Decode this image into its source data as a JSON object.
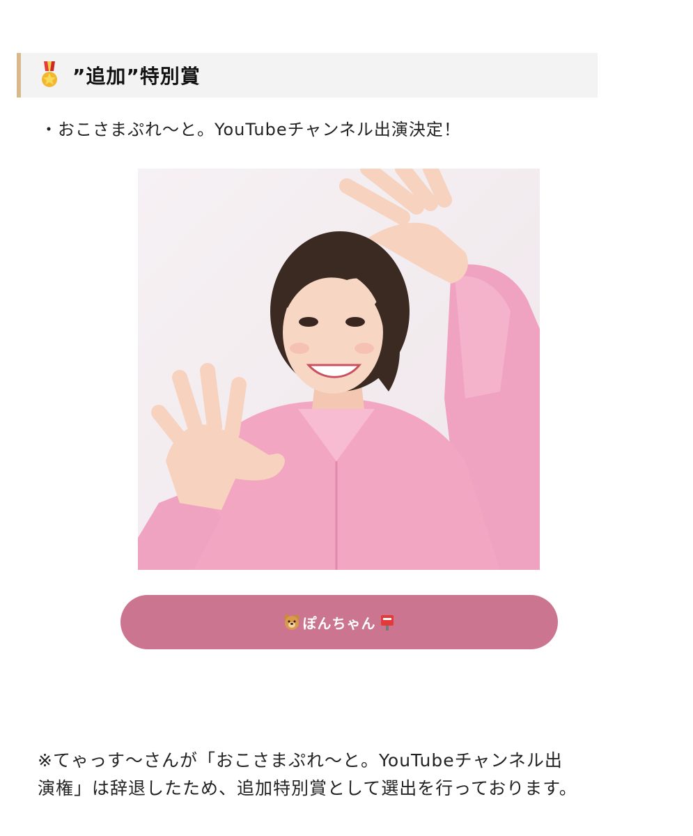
{
  "section": {
    "heading_icon": "military-medal-icon",
    "heading": "”追加”特別賞"
  },
  "bullet": "・おこさまぷれ〜と。YouTubeチャンネル出演決定！",
  "photo": {
    "subject": "woman in pink jumpsuit waving both hands",
    "colors": {
      "background": "#f4eef1",
      "outfit": "#f2a6c2",
      "hair": "#3a2a22"
    }
  },
  "button": {
    "left_icon": "bear-face-icon",
    "label": "ぽんちゃん",
    "right_icon": "postbox-icon",
    "color": "#cc7591"
  },
  "note": {
    "line1": "※てゃっす〜さんが「おこさまぷれ〜と。YouTubeチャンネル出",
    "line2": "演権」は辞退したため、追加特別賞として選出を行っております。"
  }
}
